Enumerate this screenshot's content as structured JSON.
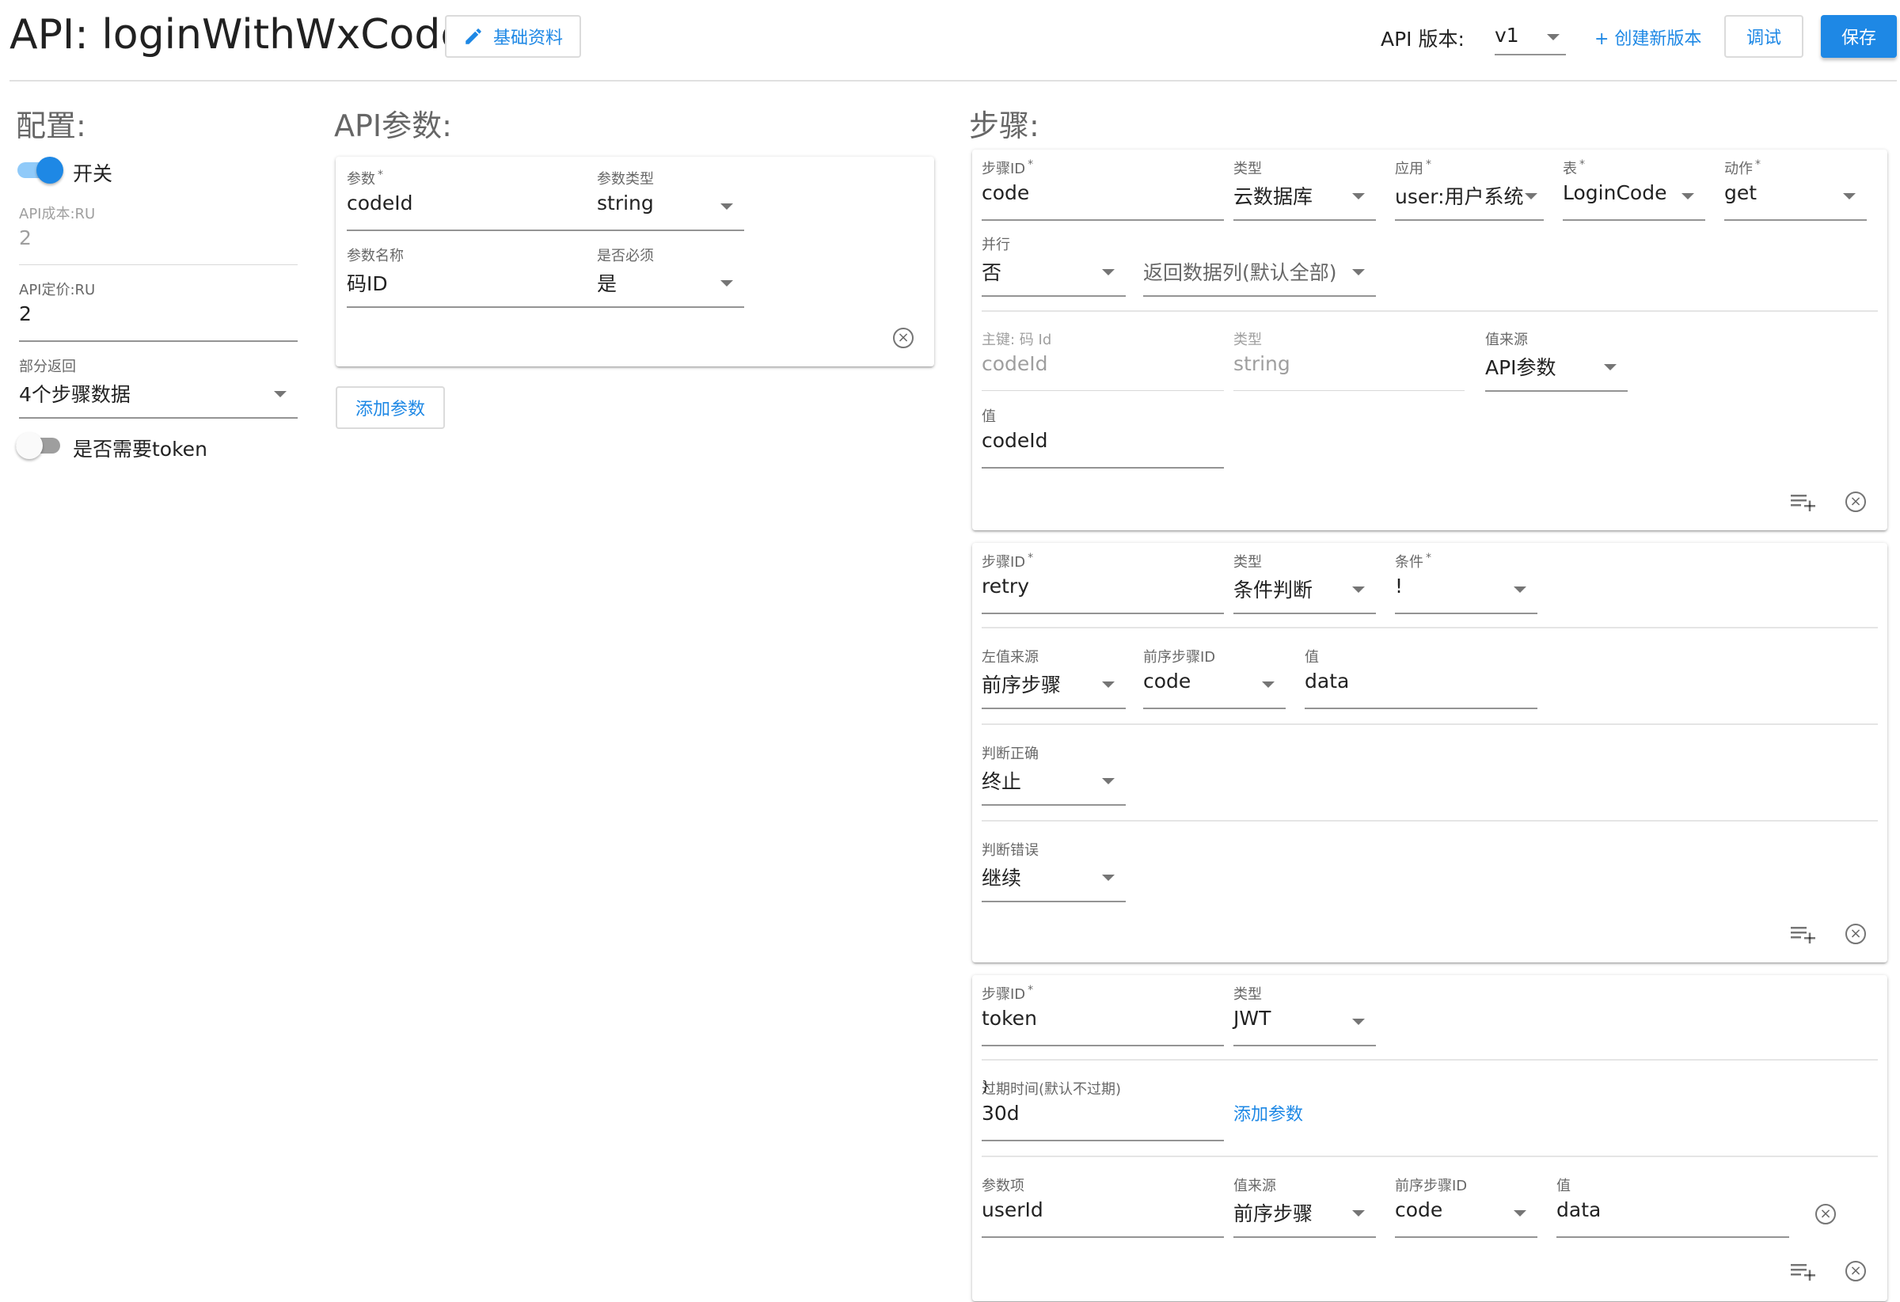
{
  "header": {
    "title": "API: loginWithWxCode",
    "basic_info_label": "基础资料",
    "api_version_label": "API 版本:",
    "api_version_value": "v1",
    "create_version_label": "+ 创建新版本",
    "debug_label": "调试",
    "save_label": "保存"
  },
  "config": {
    "title": "配置:",
    "switch_label": "开关",
    "switch_on": true,
    "cost_label": "API成本:RU",
    "cost_value": "2",
    "price_label": "API定价:RU",
    "price_value": "2",
    "partial_label": "部分返回",
    "partial_value": "4个步骤数据",
    "token_label": "是否需要token",
    "token_on": false
  },
  "api_params": {
    "title": "API参数:",
    "param_label": "参数",
    "param_value": "codeId",
    "type_label": "参数类型",
    "type_value": "string",
    "name_label": "参数名称",
    "name_value": "码ID",
    "required_label": "是否必须",
    "required_value": "是",
    "add_label": "添加参数"
  },
  "steps": {
    "title": "步骤:",
    "step1": {
      "id_label": "步骤ID",
      "id_value": "code",
      "type_label": "类型",
      "type_value": "云数据库",
      "app_label": "应用",
      "app_value": "user:用户系统",
      "table_label": "表",
      "table_value": "LoginCode",
      "action_label": "动作",
      "action_value": "get",
      "parallel_label": "并行",
      "parallel_value": "否",
      "columns_value": "返回数据列(默认全部)",
      "key_label": "主键: 码 Id",
      "key_value": "codeId",
      "key_type_label": "类型",
      "key_type_value": "string",
      "source_label": "值来源",
      "source_value": "API参数",
      "value_label": "值",
      "value_value": "codeId"
    },
    "step2": {
      "id_label": "步骤ID",
      "id_value": "retry",
      "type_label": "类型",
      "type_value": "条件判断",
      "cond_label": "条件",
      "cond_value": "!",
      "left_label": "左值来源",
      "left_value": "前序步骤",
      "prev_label": "前序步骤ID",
      "prev_value": "code",
      "val_label": "值",
      "val_value": "data",
      "true_label": "判断正确",
      "true_value": "终止",
      "false_label": "判断错误",
      "false_value": "继续"
    },
    "step3": {
      "id_label": "步骤ID",
      "id_value": "token",
      "type_label": "类型",
      "type_value": "JWT",
      "expire_label": "过期时间(默认不过期)",
      "expire_value": "30d",
      "add_param_label": "添加参数",
      "item_label": "参数项",
      "item_value": "userId",
      "source_label": "值来源",
      "source_value": "前序步骤",
      "prev_label": "前序步骤ID",
      "prev_value": "code",
      "val_label": "值",
      "val_value": "data"
    }
  },
  "colors": {
    "primary": "#1e88e5",
    "switch_track_on": "#90caf9",
    "switch_track_off": "#9e9e9e"
  }
}
